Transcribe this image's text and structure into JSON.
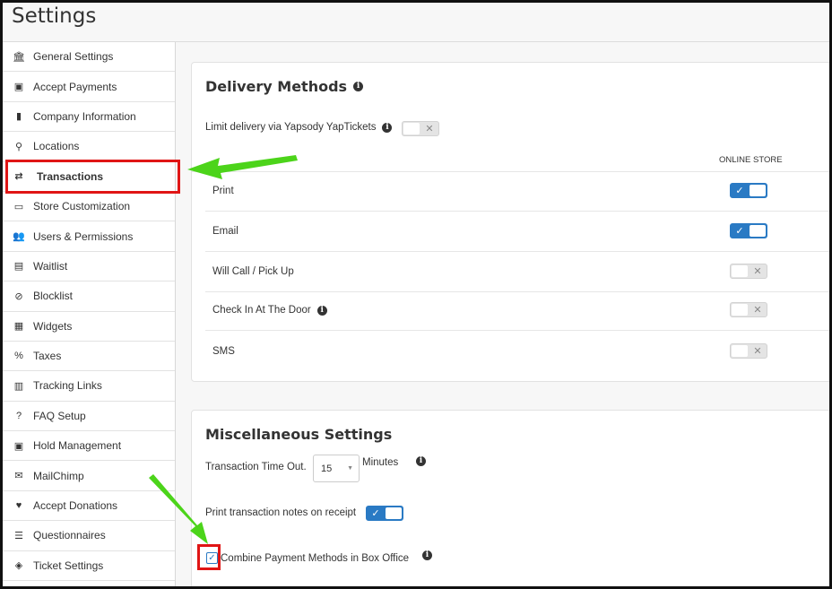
{
  "header": {
    "title": "Settings"
  },
  "sidebar": {
    "items": [
      {
        "label": "General Settings",
        "icon": "bank-icon",
        "glyph": "🏛"
      },
      {
        "label": "Accept Payments",
        "icon": "money-icon",
        "glyph": "▣"
      },
      {
        "label": "Company Information",
        "icon": "building-icon",
        "glyph": "▮"
      },
      {
        "label": "Locations",
        "icon": "map-marker-icon",
        "glyph": "⚲"
      },
      {
        "label": "Transactions",
        "icon": "exchange-icon",
        "glyph": "⇄"
      },
      {
        "label": "Store Customization",
        "icon": "desktop-icon",
        "glyph": "▭"
      },
      {
        "label": "Users & Permissions",
        "icon": "users-icon",
        "glyph": "👥"
      },
      {
        "label": "Waitlist",
        "icon": "id-card-icon",
        "glyph": "▤"
      },
      {
        "label": "Blocklist",
        "icon": "ban-icon",
        "glyph": "⊘"
      },
      {
        "label": "Widgets",
        "icon": "grid-icon",
        "glyph": "▦"
      },
      {
        "label": "Taxes",
        "icon": "percent-icon",
        "glyph": "%"
      },
      {
        "label": "Tracking Links",
        "icon": "id-badge-icon",
        "glyph": "▥"
      },
      {
        "label": "FAQ Setup",
        "icon": "question-circle-icon",
        "glyph": "?"
      },
      {
        "label": "Hold Management",
        "icon": "hospital-icon",
        "glyph": "▣"
      },
      {
        "label": "MailChimp",
        "icon": "envelope-icon",
        "glyph": "✉"
      },
      {
        "label": "Accept Donations",
        "icon": "heart-icon",
        "glyph": "♥"
      },
      {
        "label": "Questionnaires",
        "icon": "list-icon",
        "glyph": "☰"
      },
      {
        "label": "Ticket Settings",
        "icon": "ticket-icon",
        "glyph": "◈"
      }
    ],
    "active": "Transactions"
  },
  "delivery": {
    "title": "Delivery Methods",
    "limit_label": "Limit delivery via Yapsody YapTickets",
    "limit_on": false,
    "column_header": "ONLINE STORE",
    "rows": [
      {
        "label": "Print",
        "on": true
      },
      {
        "label": "Email",
        "on": true
      },
      {
        "label": "Will Call / Pick Up",
        "on": false
      },
      {
        "label": "Check In At The Door",
        "on": false,
        "info": true
      },
      {
        "label": "SMS",
        "on": false
      }
    ]
  },
  "misc": {
    "title": "Miscellaneous Settings",
    "timeout_label": "Transaction Time Out.",
    "timeout_value": "15",
    "timeout_unit": "Minutes",
    "notes_label": "Print transaction notes on receipt",
    "notes_on": true,
    "combine_label": "Combine Payment Methods in Box Office",
    "combine_checked": true
  },
  "colors": {
    "accent": "#2a7ac4",
    "highlight": "#e01515",
    "arrow": "#4cd41a"
  },
  "glyphs": {
    "check": "✓",
    "cross": "✕",
    "info": "i",
    "caret": "▼"
  }
}
